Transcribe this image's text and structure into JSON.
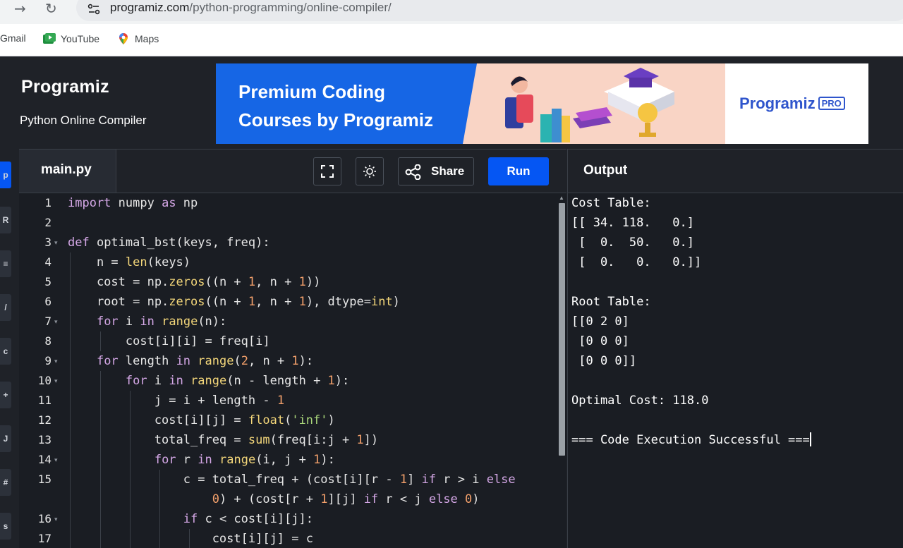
{
  "browser": {
    "url_host": "programiz.com",
    "url_path": "/python-programming/online-compiler/",
    "bookmarks": [
      "Gmail",
      "YouTube",
      "Maps"
    ]
  },
  "header": {
    "logo": "Programiz",
    "subtitle": "Python Online Compiler",
    "banner": {
      "line1": "Premium Coding",
      "line2": "Courses by Programiz",
      "pro_logo": "Programiz",
      "pro_badge": "PRO"
    }
  },
  "editor": {
    "tab": "main.py",
    "share_label": "Share",
    "run_label": "Run",
    "line_numbers": [
      "1",
      "2",
      "3",
      "4",
      "5",
      "6",
      "7",
      "8",
      "9",
      "10",
      "11",
      "12",
      "13",
      "14",
      "15",
      "",
      "16",
      "17"
    ],
    "folds": [
      "",
      "",
      "▾",
      "",
      "",
      "",
      "▾",
      "",
      "▾",
      "▾",
      "",
      "",
      "",
      "▾",
      "",
      "",
      "▾",
      ""
    ]
  },
  "output": {
    "title": "Output",
    "lines": [
      "Cost Table:",
      "[[ 34. 118.   0.]",
      " [  0.  50.   0.]",
      " [  0.   0.   0.]]",
      "",
      "Root Table:",
      "[[0 2 0]",
      " [0 0 0]",
      " [0 0 0]]",
      "",
      "Optimal Cost: 118.0",
      "",
      "=== Code Execution Successful ==="
    ]
  },
  "colors": {
    "run_button": "#0556f3",
    "keyword": "#d4a7e6",
    "builtin": "#f3d67a",
    "number": "#f3a06b",
    "string": "#a9d67a",
    "background": "#1a1d23"
  }
}
